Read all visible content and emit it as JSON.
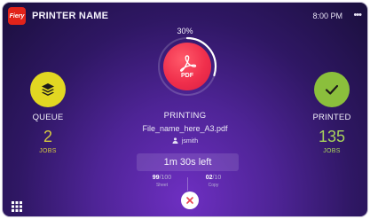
{
  "header": {
    "logo_text": "Fiery",
    "printer_name": "PRINTER NAME",
    "time": "8:00 PM",
    "more_label": "•••"
  },
  "queue": {
    "label": "QUEUE",
    "count": "2",
    "unit": "JOBS",
    "icon": "layers-icon",
    "color": "#e2d722"
  },
  "printed": {
    "label": "PRINTED",
    "count": "135",
    "unit": "JOBS",
    "icon": "checkmark-icon",
    "color": "#8bbf3c"
  },
  "job": {
    "progress_text": "30%",
    "progress": 0.3,
    "status": "PRINTING",
    "filename": "File_name_here_A3.pdf",
    "user": "jsmith",
    "time_left": "1m 30s left",
    "file_icon_label": "PDF",
    "sheets": {
      "done": "99",
      "total": "/100",
      "label": "Sheet"
    },
    "copies": {
      "done": "02",
      "total": "/10",
      "label": "Copy"
    }
  },
  "colors": {
    "accent_pdf": "#f02f4c",
    "cancel_icon": "#e8414f"
  }
}
